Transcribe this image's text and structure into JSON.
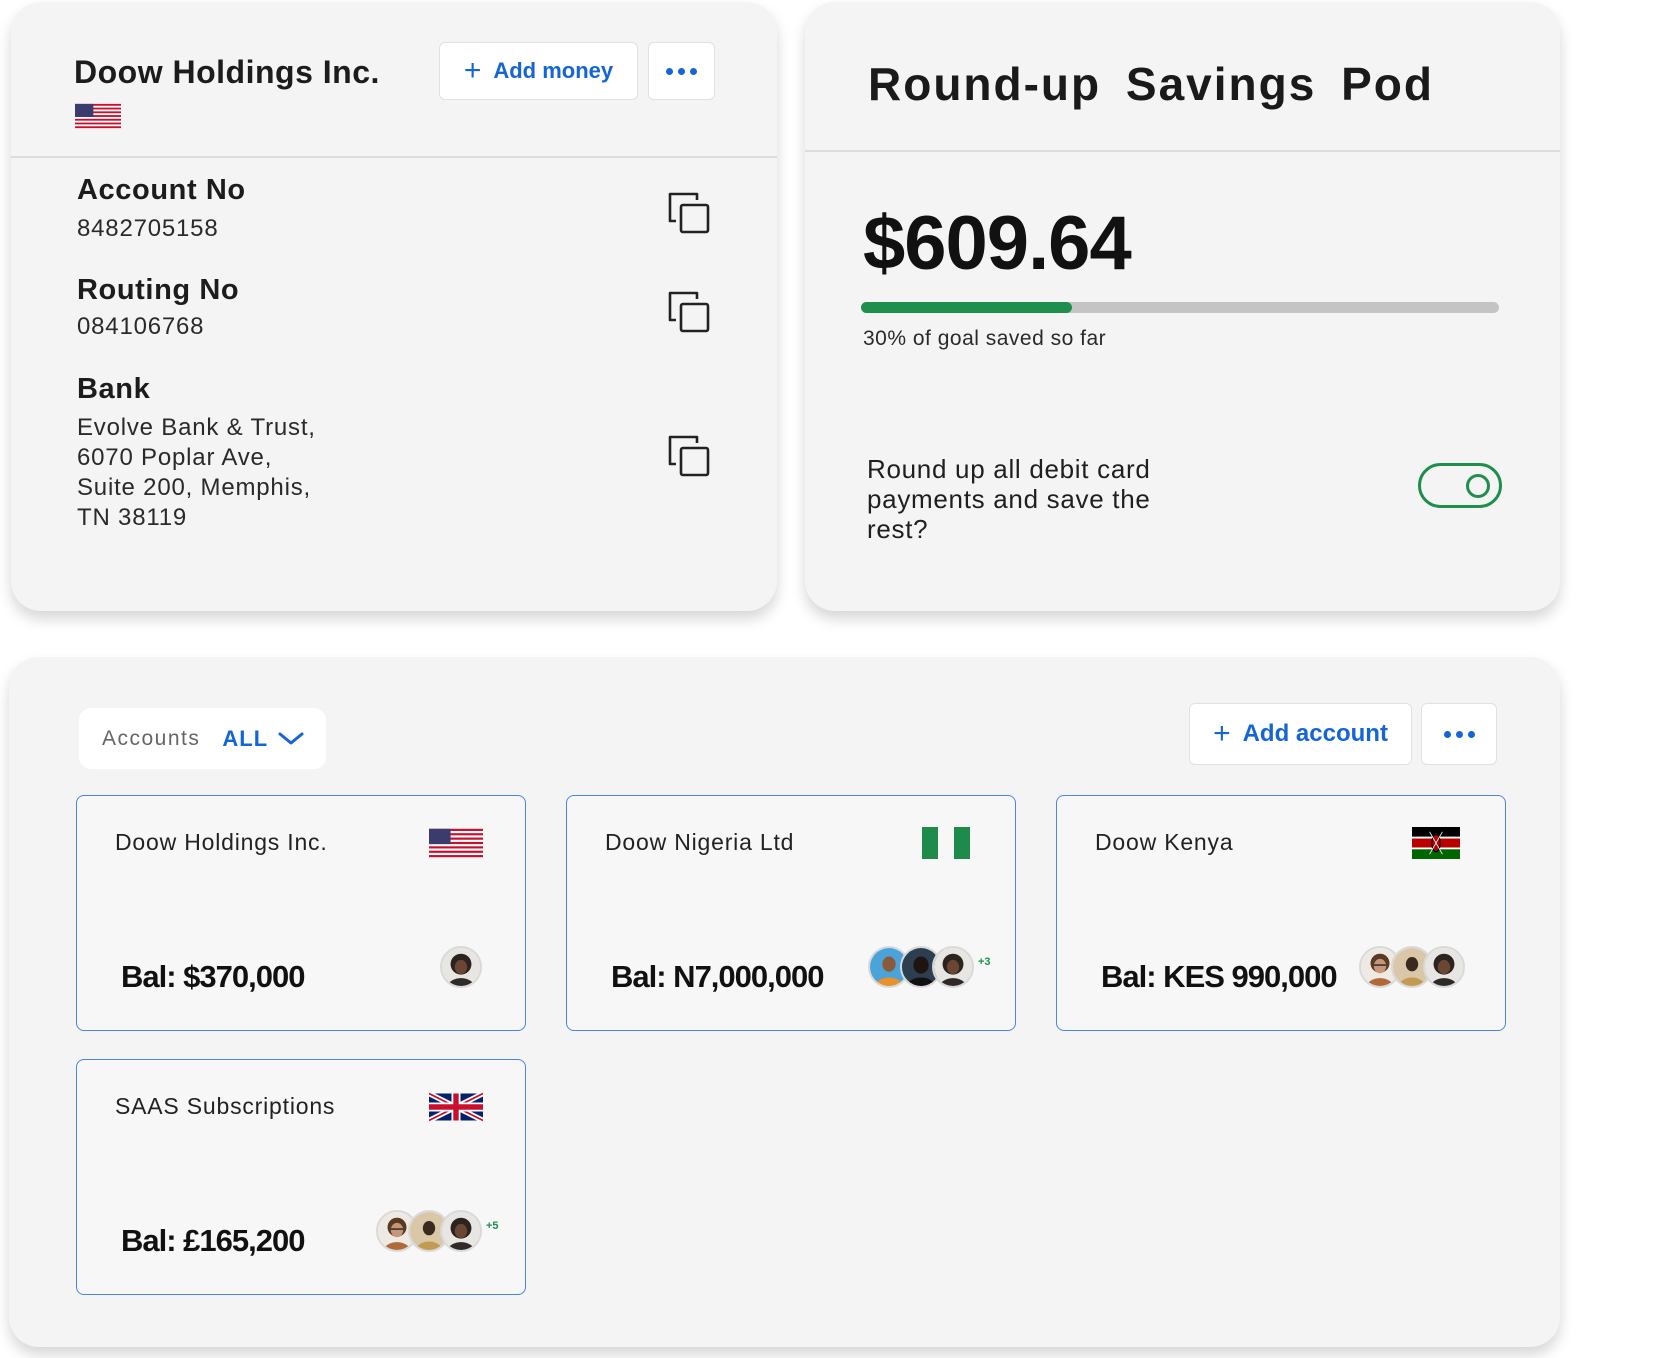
{
  "account_card": {
    "title": "Doow Holdings Inc.",
    "flag_icon": "us-flag-icon",
    "add_money_label": "Add money",
    "account_no_label": "Account No",
    "account_no_value": "8482705158",
    "routing_no_label": "Routing No",
    "routing_no_value": "084106768",
    "bank_label": "Bank",
    "bank_lines": [
      "Evolve Bank & Trust,",
      "6070 Poplar Ave,",
      "Suite 200, Memphis,",
      "TN 38119"
    ]
  },
  "savings_pod": {
    "title": "Round-up Savings Pod",
    "amount": "$609.64",
    "progress_fraction": 0.33,
    "progress_caption": "30% of goal saved so far",
    "question": "Round up all debit card payments and save the rest?",
    "toggle_on": true
  },
  "accounts_panel": {
    "filter_label": "Accounts",
    "filter_value": "ALL",
    "add_account_label": "Add account",
    "cards": [
      {
        "name": "Doow Holdings Inc.",
        "flag": "us-flag-icon",
        "balance": "Bal: $370,000",
        "extra_members": ""
      },
      {
        "name": "Doow Nigeria Ltd",
        "flag": "nigeria-flag-icon",
        "balance": "Bal: N7,000,000",
        "extra_members": "+3"
      },
      {
        "name": "Doow Kenya",
        "flag": "kenya-flag-icon",
        "balance": "Bal: KES 990,000",
        "extra_members": ""
      },
      {
        "name": "SAAS Subscriptions",
        "flag": "uk-flag-icon",
        "balance": "Bal: £165,200",
        "extra_members": "+5"
      }
    ]
  },
  "colors": {
    "accent_blue": "#1565d8",
    "success_green": "#1f8f4e",
    "card_border": "#4a86e8",
    "panel_bg": "#f4f4f4"
  }
}
